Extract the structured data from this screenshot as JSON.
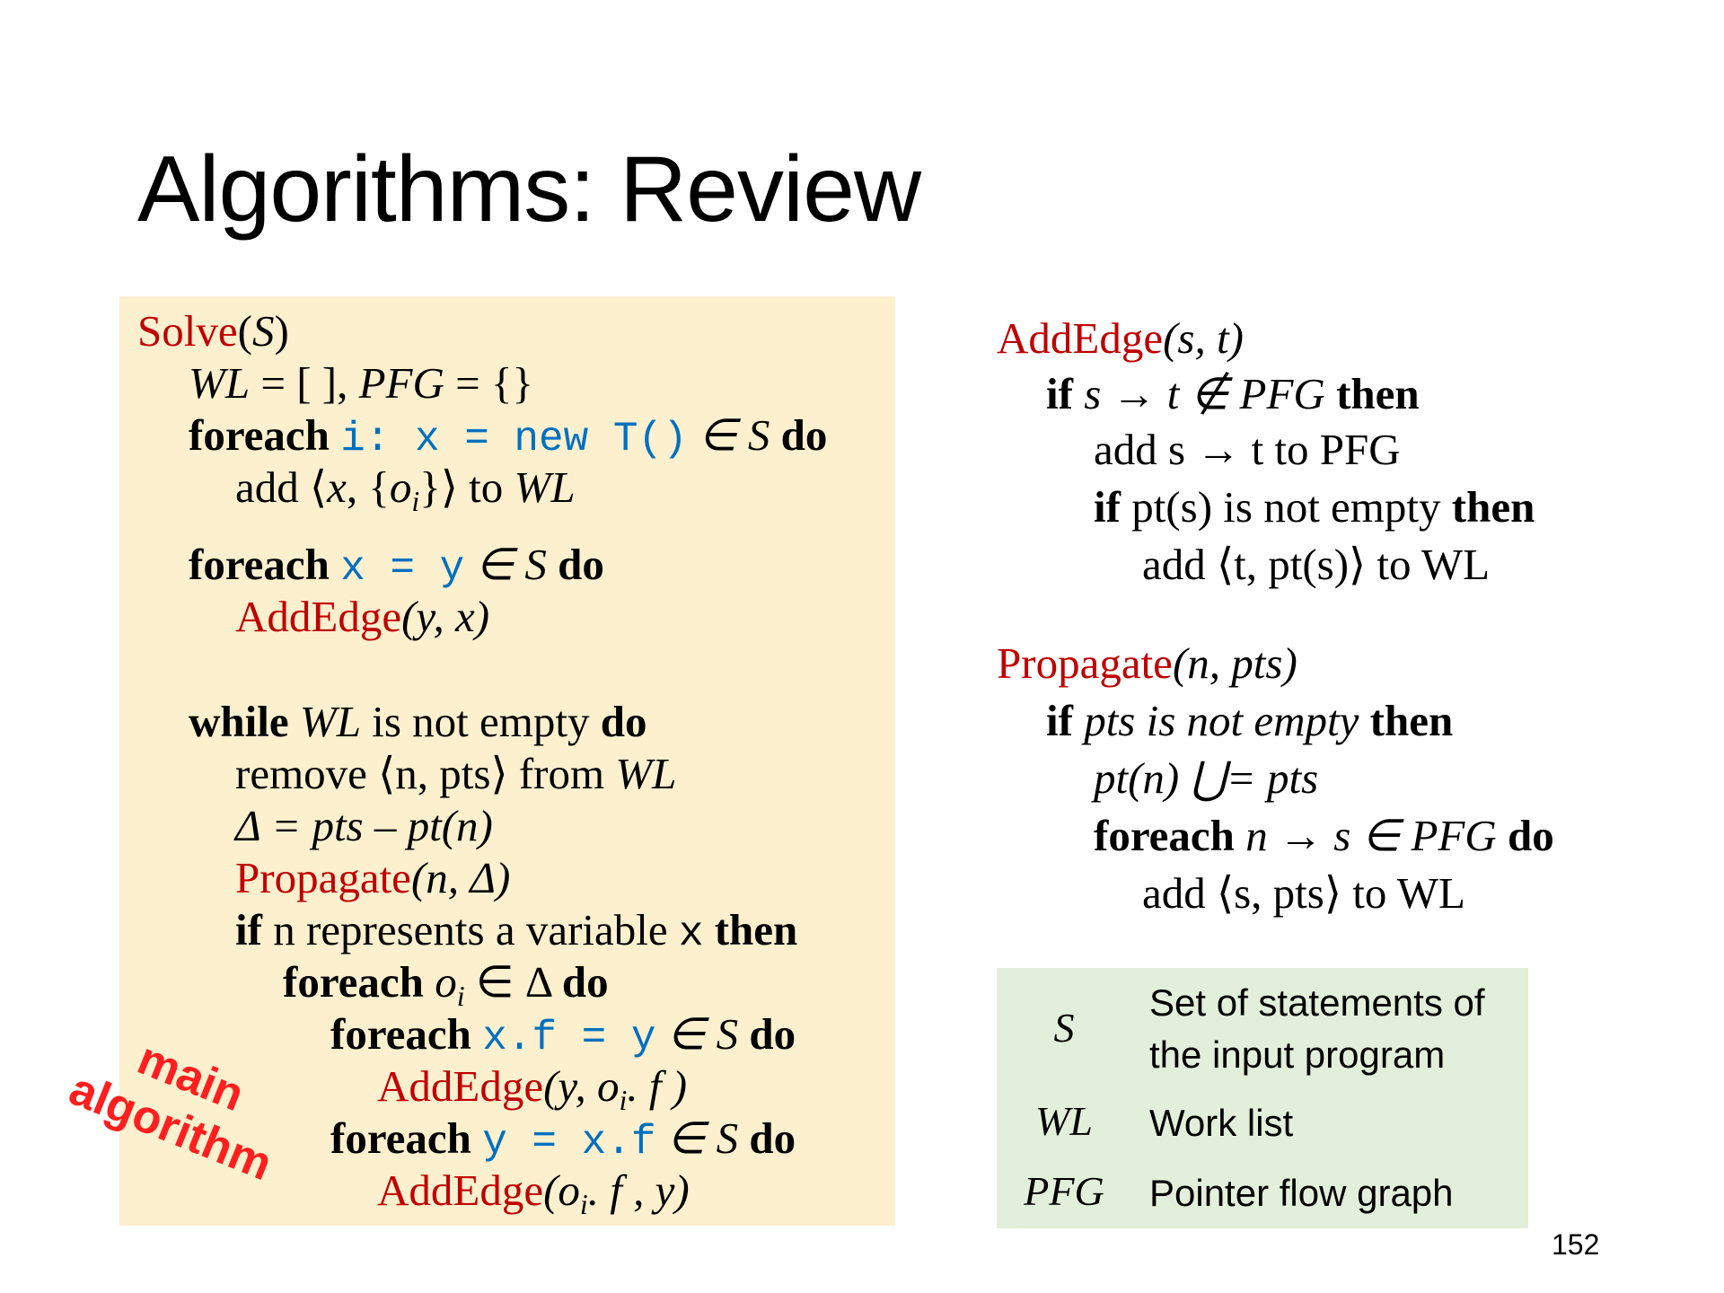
{
  "slide": {
    "title": "Algorithms: Review",
    "page_number": "152",
    "stamp": {
      "line1": "main",
      "line2": "algorithm"
    }
  },
  "solve": {
    "name": "Solve",
    "param": "S",
    "init_wl": "WL",
    "init_eq1": " = [ ], ",
    "init_pfg": "PFG",
    "init_eq2": " = {}",
    "foreach_kw": "foreach",
    "new_stmt": "i: x = new T()",
    "in_S": " ∈ S ",
    "do_kw": "do",
    "add_word": "add ",
    "add_tuple_open": "⟨",
    "add_x": "x",
    "add_set_open": ", {",
    "add_o": "o",
    "add_i": "i",
    "add_set_close": "}⟩ to ",
    "add_wl": "WL",
    "copy_stmt": "x = y",
    "addedge1_name": "AddEdge",
    "addedge1_args": "(y, x)",
    "while_kw": "while",
    "while_wl": "WL",
    "while_rest": " is not empty ",
    "remove_text": "remove ⟨n, pts⟩ from ",
    "remove_wl": "WL",
    "delta_text": "Δ = pts – pt(n)",
    "propagate_name": "Propagate",
    "propagate_args": "(n, Δ)",
    "if_kw": "if",
    "if_text": " n represents a variable ",
    "if_var": "x",
    "then_kw": "then",
    "foreach_oi_text": " o",
    "foreach_oi_sub": "i",
    "foreach_oi_rest": " ∈ Δ ",
    "store_stmt": "x.f = y",
    "addedge2_name": "AddEdge",
    "addedge2_args": "(y, o",
    "addedge2_sub": "i",
    "addedge2_tail": ". f )",
    "load_stmt": "y = x.f",
    "addedge3_name": "AddEdge",
    "addedge3_args": "(o",
    "addedge3_sub": "i",
    "addedge3_tail": ". f , y)"
  },
  "addedge": {
    "name": "AddEdge",
    "args": "(s, t)",
    "if_kw": "if",
    "cond": " s → t ∉ PFG ",
    "then_kw": "then",
    "add_line": "add s → t to PFG",
    "if2_kw": "if",
    "cond2": " pt(s) is not empty ",
    "then2_kw": "then",
    "add2_line": "add ⟨t, pt(s)⟩ to WL"
  },
  "propagate": {
    "name": "Propagate",
    "args": "(n, pts)",
    "if_kw": "if",
    "cond": " pts is not empty ",
    "then_kw": "then",
    "union_line": "pt(n) ⋃= pts",
    "foreach_kw": "foreach",
    "foreach_cond": " n → s ∈ PFG ",
    "do_kw": "do",
    "add_line": "add ⟨s, pts⟩ to WL"
  },
  "legend": {
    "rows": [
      {
        "symbol": "S",
        "desc_line1": "Set of statements of",
        "desc_line2": "the input program"
      },
      {
        "symbol": "WL",
        "desc_line1": "Work list"
      },
      {
        "symbol": "PFG",
        "desc_line1": "Pointer flow graph"
      }
    ]
  },
  "colors": {
    "panel_bg": "#fdf0cf",
    "legend_bg": "#e2efda",
    "function_name": "#c00000",
    "code": "#0070c0",
    "stamp": "#ff1f1f"
  }
}
